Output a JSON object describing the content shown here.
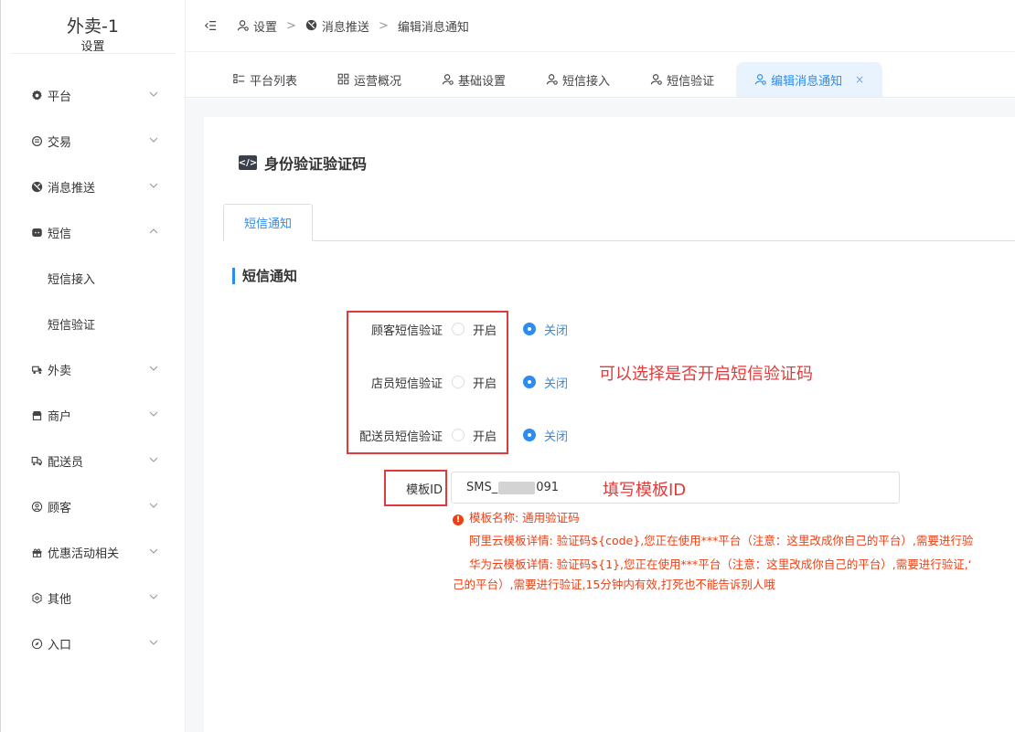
{
  "brand": {
    "title": "外卖-1",
    "subtitle": "设置"
  },
  "sidebar": {
    "items": [
      {
        "label": "平台",
        "icon": "gear-icon"
      },
      {
        "label": "交易",
        "icon": "trade-icon"
      },
      {
        "label": "消息推送",
        "icon": "message-push-icon"
      },
      {
        "label": "短信",
        "icon": "sms-icon"
      },
      {
        "label": "外卖",
        "icon": "delivery-icon"
      },
      {
        "label": "商户",
        "icon": "store-icon"
      },
      {
        "label": "配送员",
        "icon": "courier-icon"
      },
      {
        "label": "顾客",
        "icon": "customer-icon"
      },
      {
        "label": "优惠活动相关",
        "icon": "gift-icon"
      },
      {
        "label": "其他",
        "icon": "hexagon-icon"
      },
      {
        "label": "入口",
        "icon": "compass-icon"
      }
    ],
    "sms_children": [
      "短信接入",
      "短信验证"
    ]
  },
  "breadcrumb": {
    "items": [
      "设置",
      "消息推送",
      "编辑消息通知"
    ],
    "separator": ">"
  },
  "tabs": [
    "平台列表",
    "运营概况",
    "基础设置",
    "短信接入",
    "短信验证",
    "编辑消息通知"
  ],
  "tab_close": "×",
  "page": {
    "title": "身份验证验证码",
    "inner_tab": "短信通知",
    "form_heading": "短信通知"
  },
  "form": {
    "rows": [
      {
        "label": "顾客短信验证",
        "on": "开启",
        "off": "关闭"
      },
      {
        "label": "店员短信验证",
        "on": "开启",
        "off": "关闭"
      },
      {
        "label": "配送员短信验证",
        "on": "开启",
        "off": "关闭"
      }
    ],
    "template_label": "模板ID",
    "template_value_prefix": "SMS_",
    "template_value_suffix": "091",
    "help": {
      "line1": "模板名称: 通用验证码",
      "line2": "阿里云模板详情: 验证码${code},您正在使用***平台（注意：这里改成你自己的平台）,需要进行验",
      "line3": "华为云模板详情: 验证码${1},您正在使用***平台（注意：这里改成你自己的平台）,需要进行验证,‘",
      "line4": "己的平台）,需要进行验证,15分钟内有效,打死也不能告诉别人哦"
    }
  },
  "annotations": {
    "radio_note": "可以选择是否开启短信验证码",
    "template_note": "填写模板ID"
  },
  "colors": {
    "accent": "#2d8cf0",
    "annotation": "#e03a3a",
    "error": "#ed4014"
  }
}
